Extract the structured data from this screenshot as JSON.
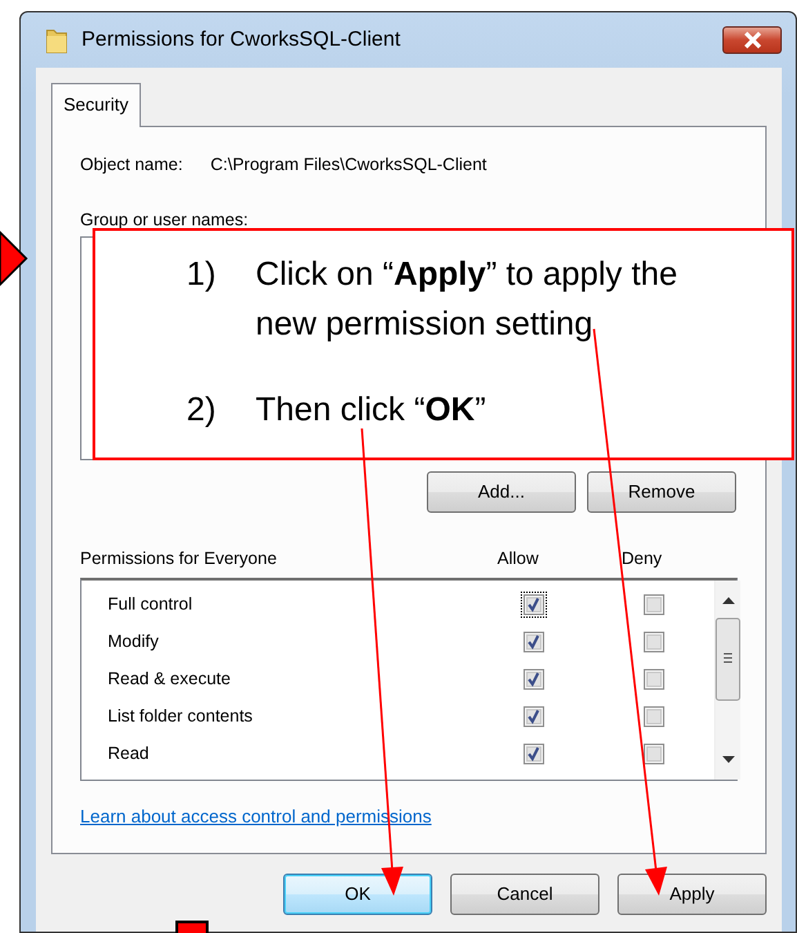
{
  "window": {
    "title": "Permissions for CworksSQL-Client"
  },
  "tabs": [
    {
      "label": "Security",
      "selected": true
    }
  ],
  "object_name": {
    "label": "Object name:",
    "value": "C:\\Program Files\\CworksSQL-Client"
  },
  "group_label": "Group or user names:",
  "group_buttons": [
    "Add...",
    "Remove"
  ],
  "permissions": {
    "label": "Permissions for Everyone",
    "columns": [
      "Allow",
      "Deny"
    ],
    "rows": [
      {
        "name": "Full control",
        "allow": true,
        "deny": false,
        "focused": true
      },
      {
        "name": "Modify",
        "allow": true,
        "deny": false,
        "focused": false
      },
      {
        "name": "Read & execute",
        "allow": true,
        "deny": false,
        "focused": false
      },
      {
        "name": "List folder contents",
        "allow": true,
        "deny": false,
        "focused": false
      },
      {
        "name": "Read",
        "allow": true,
        "deny": false,
        "focused": false
      }
    ]
  },
  "link": "Learn about access control and permissions",
  "buttons": [
    {
      "label": "OK",
      "default": true
    },
    {
      "label": "Cancel",
      "default": false
    },
    {
      "label": "Apply",
      "default": false
    }
  ],
  "callout": {
    "steps": [
      {
        "number": "1)",
        "text": "Click on “**Apply**” to apply the new permission setting"
      },
      {
        "number": "2)",
        "text": "Then click “**OK**”"
      }
    ]
  }
}
